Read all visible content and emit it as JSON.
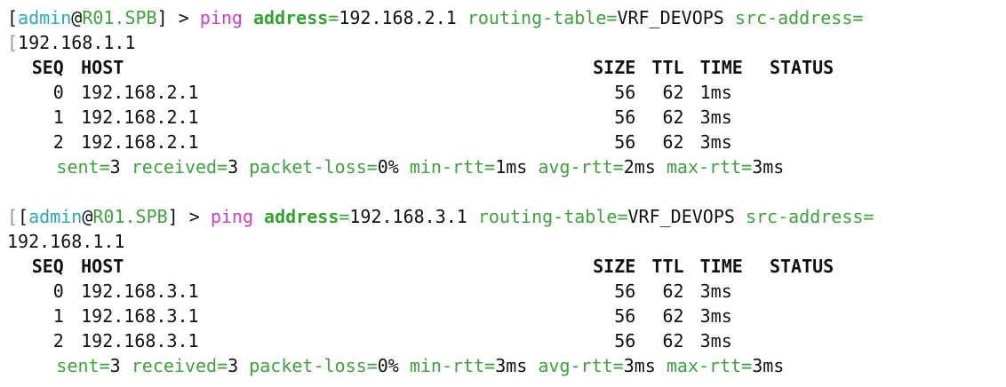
{
  "blocks": [
    {
      "prompt": {
        "open": "[",
        "user": "admin",
        "at": "@",
        "host": "R01.SPB",
        "close": "] > ",
        "command": "ping",
        "params": [
          {
            "key": "address",
            "eq": "=",
            "value": "192.168.2.1"
          },
          {
            "key": "routing-table",
            "eq": "=",
            "value": "VRF_DEVOPS"
          },
          {
            "key": "src-address",
            "eq": "=",
            "value": ""
          }
        ],
        "wrap_marker": "[",
        "wrap_value": "192.168.1.1"
      },
      "headers": {
        "seq": "SEQ",
        "host": "HOST",
        "size": "SIZE",
        "ttl": "TTL",
        "time": "TIME",
        "status": "STATUS"
      },
      "rows": [
        {
          "seq": "0",
          "host": "192.168.2.1",
          "size": "56",
          "ttl": "62",
          "time": "1ms"
        },
        {
          "seq": "1",
          "host": "192.168.2.1",
          "size": "56",
          "ttl": "62",
          "time": "3ms"
        },
        {
          "seq": "2",
          "host": "192.168.2.1",
          "size": "56",
          "ttl": "62",
          "time": "3ms"
        }
      ],
      "stats": [
        {
          "key": "sent",
          "value": "3"
        },
        {
          "key": "received",
          "value": "3"
        },
        {
          "key": "packet-loss",
          "value": "0%"
        },
        {
          "key": "min-rtt",
          "value": "1ms"
        },
        {
          "key": "avg-rtt",
          "value": "2ms"
        },
        {
          "key": "max-rtt",
          "value": "3ms"
        }
      ]
    },
    {
      "prompt": {
        "open": "[",
        "user": "admin",
        "at": "@",
        "host": "R01.SPB",
        "close": "] > ",
        "command": "ping",
        "params": [
          {
            "key": "address",
            "eq": "=",
            "value": "192.168.3.1"
          },
          {
            "key": "routing-table",
            "eq": "=",
            "value": "VRF_DEVOPS"
          },
          {
            "key": "src-address",
            "eq": "=",
            "value": ""
          }
        ],
        "wrap_marker": "",
        "wrap_value": "192.168.1.1",
        "leading_marker": "["
      },
      "headers": {
        "seq": "SEQ",
        "host": "HOST",
        "size": "SIZE",
        "ttl": "TTL",
        "time": "TIME",
        "status": "STATUS"
      },
      "rows": [
        {
          "seq": "0",
          "host": "192.168.3.1",
          "size": "56",
          "ttl": "62",
          "time": "3ms"
        },
        {
          "seq": "1",
          "host": "192.168.3.1",
          "size": "56",
          "ttl": "62",
          "time": "3ms"
        },
        {
          "seq": "2",
          "host": "192.168.3.1",
          "size": "56",
          "ttl": "62",
          "time": "3ms"
        }
      ],
      "stats": [
        {
          "key": "sent",
          "value": "3"
        },
        {
          "key": "received",
          "value": "3"
        },
        {
          "key": "packet-loss",
          "value": "0%"
        },
        {
          "key": "min-rtt",
          "value": "3ms"
        },
        {
          "key": "avg-rtt",
          "value": "3ms"
        },
        {
          "key": "max-rtt",
          "value": "3ms"
        }
      ]
    }
  ],
  "colors": {
    "background": "#ffffff",
    "text": "#111111",
    "user": "#2aa8b8",
    "host": "#3ea33e",
    "command": "#d13cd1",
    "param_key": "#2fa62f"
  }
}
